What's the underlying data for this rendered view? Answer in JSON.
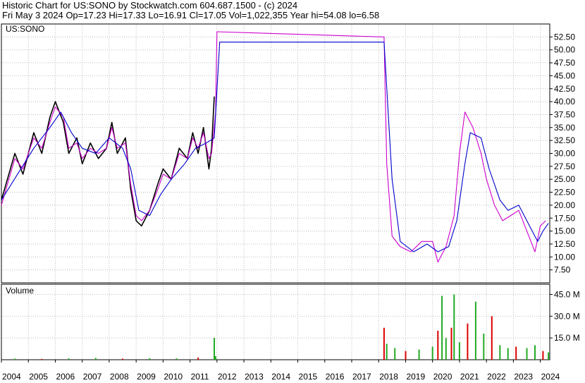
{
  "header": {
    "line1": "Historic Chart for US:SONO by Stockwatch.com 604.687.1500 - (c) 2024",
    "line2": "Fri May  3 2024   Op=17.23  Hi=17.33  Lo=16.91  Cl=17.05  Vol=1,022,355  Year hi=54.08  lo=6.58"
  },
  "colors": {
    "price": "#000000",
    "ma_short": "#cc00cc",
    "ma_long": "#0000cc",
    "vol_up": "#22aa22",
    "vol_down": "#dd0000",
    "grid": "#bbbbbb"
  },
  "chart_data": [
    {
      "type": "line",
      "panel": "price",
      "title": "US:SONO",
      "ylim": [
        5,
        55
      ],
      "y_ticks": [
        "7.50",
        "10.00",
        "12.50",
        "15.00",
        "17.50",
        "20.00",
        "22.50",
        "25.00",
        "27.50",
        "30.00",
        "32.50",
        "35.00",
        "37.50",
        "40.00",
        "42.50",
        "45.00",
        "47.50",
        "50.00",
        "52.50"
      ],
      "x_ticks": [
        "2004",
        "2005",
        "2006",
        "2007",
        "2008",
        "2009",
        "2010",
        "2011",
        "2012",
        "2013",
        "2014",
        "2015",
        "2016",
        "2017",
        "2018",
        "2019",
        "2020",
        "2021",
        "2022",
        "2023",
        "2024"
      ],
      "series": [
        {
          "values": [
            [
              2004.0,
              21
            ],
            [
              2004.5,
              30
            ],
            [
              2004.8,
              26
            ],
            [
              2005.2,
              34
            ],
            [
              2005.5,
              30
            ],
            [
              2005.8,
              37
            ],
            [
              2006.0,
              40
            ],
            [
              2006.3,
              36
            ],
            [
              2006.5,
              30
            ],
            [
              2006.8,
              33
            ],
            [
              2007.0,
              28
            ],
            [
              2007.3,
              32
            ],
            [
              2007.6,
              29
            ],
            [
              2007.9,
              31
            ],
            [
              2008.1,
              36
            ],
            [
              2008.3,
              30
            ],
            [
              2008.6,
              33
            ],
            [
              2008.8,
              23
            ],
            [
              2009.0,
              17
            ],
            [
              2009.2,
              16
            ],
            [
              2009.5,
              19
            ],
            [
              2009.8,
              24
            ],
            [
              2010.0,
              27
            ],
            [
              2010.3,
              25
            ],
            [
              2010.6,
              31
            ],
            [
              2010.9,
              29
            ],
            [
              2011.1,
              34
            ],
            [
              2011.3,
              30
            ],
            [
              2011.5,
              35
            ],
            [
              2011.7,
              27
            ],
            [
              2011.8,
              31
            ],
            [
              2011.9,
              41
            ]
          ]
        },
        {
          "name": "",
          "values": [
            [
              2004.0,
              20
            ],
            [
              2004.5,
              29
            ],
            [
              2004.8,
              27
            ],
            [
              2005.2,
              33
            ],
            [
              2005.5,
              31
            ],
            [
              2005.8,
              36
            ],
            [
              2006.0,
              39
            ],
            [
              2006.3,
              37
            ],
            [
              2006.5,
              31
            ],
            [
              2006.8,
              32
            ],
            [
              2007.0,
              29
            ],
            [
              2007.3,
              31
            ],
            [
              2007.6,
              30
            ],
            [
              2007.9,
              31
            ],
            [
              2008.1,
              35
            ],
            [
              2008.3,
              31
            ],
            [
              2008.6,
              32
            ],
            [
              2008.8,
              24
            ],
            [
              2009.0,
              18
            ],
            [
              2009.2,
              17
            ],
            [
              2009.5,
              19
            ],
            [
              2009.8,
              23
            ],
            [
              2010.0,
              26
            ],
            [
              2010.3,
              25
            ],
            [
              2010.6,
              30
            ],
            [
              2010.9,
              29
            ],
            [
              2011.1,
              33
            ],
            [
              2011.3,
              31
            ],
            [
              2011.5,
              34
            ],
            [
              2011.7,
              29
            ],
            [
              2011.8,
              30
            ],
            [
              2011.95,
              38
            ],
            [
              2012.0,
              53.5
            ],
            [
              2018.2,
              52.5
            ],
            [
              2018.3,
              28
            ],
            [
              2018.5,
              14
            ],
            [
              2018.8,
              12
            ],
            [
              2019.2,
              11
            ],
            [
              2019.6,
              13
            ],
            [
              2020.0,
              13
            ],
            [
              2020.2,
              9
            ],
            [
              2020.5,
              12
            ],
            [
              2020.8,
              18
            ],
            [
              2021.0,
              30
            ],
            [
              2021.2,
              38
            ],
            [
              2021.5,
              35
            ],
            [
              2021.8,
              30
            ],
            [
              2022.0,
              25
            ],
            [
              2022.3,
              20
            ],
            [
              2022.6,
              17
            ],
            [
              2022.9,
              18
            ],
            [
              2023.2,
              19
            ],
            [
              2023.5,
              15
            ],
            [
              2023.8,
              11
            ],
            [
              2024.0,
              16
            ],
            [
              2024.2,
              17
            ]
          ]
        },
        {
          "name": "",
          "values": [
            [
              2004.0,
              21
            ],
            [
              2004.6,
              26
            ],
            [
              2005.2,
              31
            ],
            [
              2005.8,
              35
            ],
            [
              2006.2,
              38
            ],
            [
              2006.6,
              34
            ],
            [
              2007.0,
              31
            ],
            [
              2007.5,
              30
            ],
            [
              2008.0,
              33
            ],
            [
              2008.5,
              31
            ],
            [
              2008.8,
              27
            ],
            [
              2009.1,
              19
            ],
            [
              2009.5,
              18
            ],
            [
              2009.9,
              22
            ],
            [
              2010.3,
              25
            ],
            [
              2010.8,
              28
            ],
            [
              2011.2,
              31
            ],
            [
              2011.6,
              32
            ],
            [
              2011.9,
              33
            ],
            [
              2012.1,
              51.5
            ],
            [
              2018.2,
              51.5
            ],
            [
              2018.5,
              25
            ],
            [
              2018.8,
              13
            ],
            [
              2019.3,
              11
            ],
            [
              2019.8,
              12.5
            ],
            [
              2020.2,
              11
            ],
            [
              2020.6,
              12
            ],
            [
              2020.9,
              17
            ],
            [
              2021.2,
              28
            ],
            [
              2021.4,
              34
            ],
            [
              2021.8,
              33
            ],
            [
              2022.1,
              27
            ],
            [
              2022.5,
              21
            ],
            [
              2022.8,
              19
            ],
            [
              2023.2,
              20
            ],
            [
              2023.6,
              16
            ],
            [
              2023.9,
              13
            ],
            [
              2024.1,
              15
            ],
            [
              2024.3,
              16.5
            ]
          ]
        }
      ]
    },
    {
      "type": "bar",
      "panel": "volume",
      "title": "Volume",
      "ylim": [
        0,
        52
      ],
      "y_ticks": [
        "15.0 M",
        "30.0 M",
        "45.0 M"
      ],
      "x_ticks": [
        "2004",
        "2005",
        "2006",
        "2007",
        "2008",
        "2009",
        "2010",
        "2011",
        "2012",
        "2013",
        "2014",
        "2015",
        "2016",
        "2017",
        "2018",
        "2019",
        "2020",
        "2021",
        "2022",
        "2023",
        "2024"
      ],
      "values": [
        [
          2004.5,
          0.8
        ],
        [
          2005.5,
          0.6
        ],
        [
          2006.5,
          0.9
        ],
        [
          2007.5,
          1.2
        ],
        [
          2008.5,
          0.8
        ],
        [
          2009.5,
          1.0
        ],
        [
          2010.5,
          0.9
        ],
        [
          2011.3,
          1.5
        ],
        [
          2011.9,
          15
        ],
        [
          2011.95,
          2.5
        ],
        [
          2018.2,
          22
        ],
        [
          2018.3,
          11
        ],
        [
          2018.6,
          8
        ],
        [
          2019.0,
          6
        ],
        [
          2019.5,
          7
        ],
        [
          2020.0,
          9
        ],
        [
          2020.2,
          20
        ],
        [
          2020.35,
          44
        ],
        [
          2020.5,
          15
        ],
        [
          2020.7,
          22
        ],
        [
          2020.8,
          45
        ],
        [
          2021.0,
          12
        ],
        [
          2021.3,
          25
        ],
        [
          2021.6,
          40
        ],
        [
          2021.9,
          18
        ],
        [
          2022.2,
          30
        ],
        [
          2022.5,
          10
        ],
        [
          2022.8,
          8
        ],
        [
          2023.1,
          9
        ],
        [
          2023.5,
          8
        ],
        [
          2023.8,
          10
        ],
        [
          2024.1,
          6
        ],
        [
          2024.3,
          5
        ]
      ]
    }
  ]
}
